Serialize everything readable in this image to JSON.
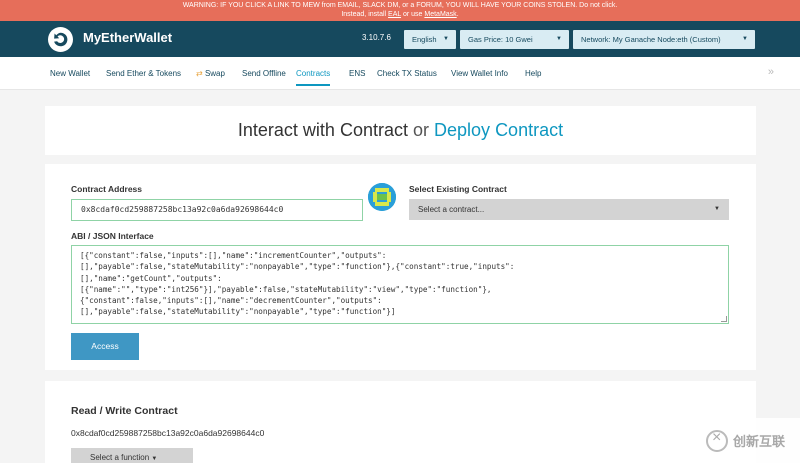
{
  "warning": {
    "line1": "WARNING: IF YOU CLICK A LINK TO MEW from EMAIL, SLACK DM, or a FORUM, YOU WILL HAVE YOUR COINS STOLEN. Do not click.",
    "line2_prefix": "Instead, install ",
    "eal_link": "EAL",
    "line2_middle": " or use ",
    "metamask_link": "MetaMask",
    "line2_suffix": "."
  },
  "header": {
    "brand": "MyEtherWallet",
    "version": "3.10.7.6",
    "language": "English",
    "gas_price": "Gas Price: 10 Gwei",
    "network": "Network: My Ganache Node:eth (Custom)"
  },
  "nav": {
    "items": [
      "New Wallet",
      "Send Ether & Tokens",
      "Swap",
      "Send Offline",
      "Contracts",
      "ENS",
      "Check TX Status",
      "View Wallet Info",
      "Help"
    ],
    "active": "Contracts",
    "more": "»"
  },
  "title": {
    "interact": "Interact with Contract",
    "or": "or",
    "deploy": "Deploy Contract"
  },
  "form": {
    "contract_address_label": "Contract Address",
    "contract_address_value": "0x8cdaf0cd259887258bc13a92c0a6da92698644c0",
    "existing_label": "Select Existing Contract",
    "existing_placeholder": "Select a contract...",
    "abi_label": "ABI / JSON Interface",
    "abi_value": "[{\"constant\":false,\"inputs\":[],\"name\":\"incrementCounter\",\"outputs\":\n[],\"payable\":false,\"stateMutability\":\"nonpayable\",\"type\":\"function\"},{\"constant\":true,\"inputs\":\n[],\"name\":\"getCount\",\"outputs\":\n[{\"name\":\"\",\"type\":\"int256\"}],\"payable\":false,\"stateMutability\":\"view\",\"type\":\"function\"},\n{\"constant\":false,\"inputs\":[],\"name\":\"decrementCounter\",\"outputs\":\n[],\"payable\":false,\"stateMutability\":\"nonpayable\",\"type\":\"function\"}]",
    "access_button": "Access"
  },
  "read_write": {
    "title": "Read / Write Contract",
    "address": "0x8cdaf0cd259887258bc13a92c0a6da92698644c0",
    "function_select": "Select a function"
  },
  "watermark": {
    "text": "创新互联"
  },
  "colors": {
    "header_bg": "#16495e",
    "warning_bg": "#e66e5a",
    "accent": "#0e97c0",
    "access_button": "#3f97c4"
  }
}
